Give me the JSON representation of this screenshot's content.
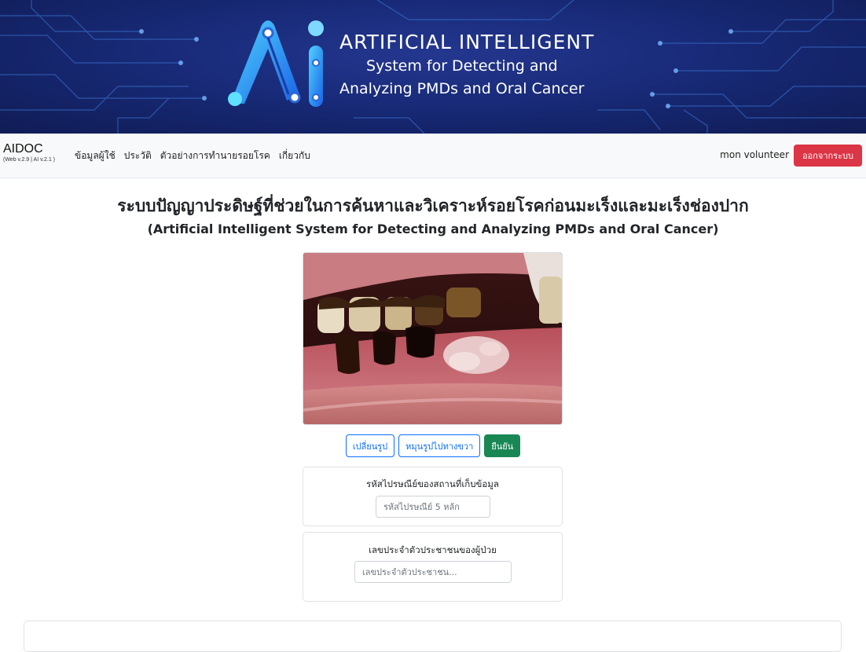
{
  "banner": {
    "logo_text": "Ai",
    "title": "ARTIFICIAL INTELLIGENT",
    "subtitle_line1": "System for Detecting and",
    "subtitle_line2": "Analyzing PMDs and Oral Cancer"
  },
  "navbar": {
    "brand": "AIDOC",
    "version": "(Web v.2.9 | AI v.2.1 )",
    "links": [
      "ข้อมูลผู้ใช้",
      "ประวัติ",
      "ตัวอย่างการทำนายรอยโรค",
      "เกี่ยวกับ"
    ],
    "user": "mon volunteer",
    "logout_label": "ออกจากระบบ"
  },
  "main": {
    "title_th": "ระบบปัญญาประดิษฐ์ที่ช่วยในการค้นหาและวิเคราะห์รอยโรคก่อนมะเร็งและมะเร็งช่องปาก",
    "title_en": "(Artificial Intelligent System for Detecting and Analyzing PMDs and Oral Cancer)",
    "buttons": {
      "change_image": "เปลี่ยนรูป",
      "rotate_right": "หมุนรูปไปทางขวา",
      "confirm": "ยืนยัน"
    },
    "postcode": {
      "label": "รหัสไปรษณีย์ของสถานที่เก็บข้อมูล",
      "placeholder": "รหัสไปรษณีย์ 5 หลัก"
    },
    "citizen_id": {
      "label": "เลขประจำตัวประชาชนของผู้ป่วย",
      "placeholder": "เลขประจำตัวประชาชน..."
    }
  },
  "colors": {
    "banner_bg": "#182a78",
    "logout": "#dc3545",
    "primary": "#0d6efd",
    "success": "#198754"
  }
}
